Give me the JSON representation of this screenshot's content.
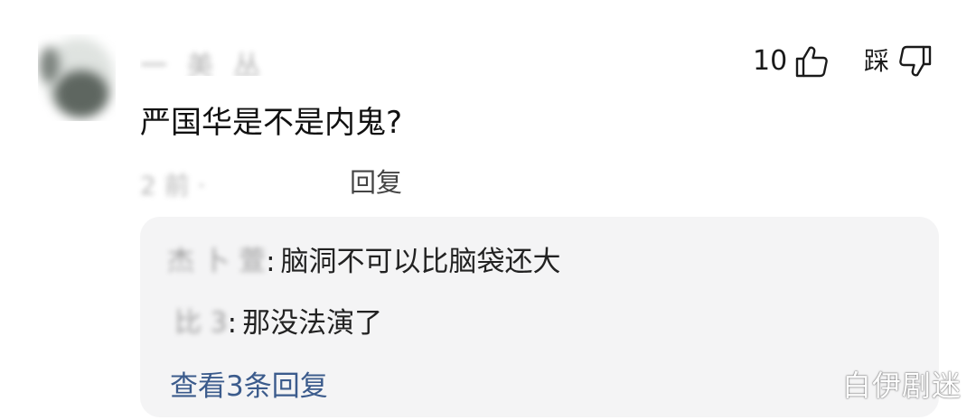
{
  "comment": {
    "username": "一 美 丛",
    "like_count": "10",
    "dislike_label": "踩",
    "text": "严国华是不是内鬼?",
    "meta_prefix": "2  前 ·",
    "reply_label": "回复"
  },
  "replies": {
    "items": [
      {
        "author": "杰 卜 萱",
        "separator": ":",
        "text": "脑洞不可以比脑袋还大"
      },
      {
        "author": "比  3",
        "separator": ":",
        "text": "那没法演了"
      }
    ],
    "view_more_label": "查看3条回复"
  },
  "watermark": "白伊剧迷",
  "colors": {
    "link_blue": "#3b5b8c",
    "reply_bg": "#f4f4f5",
    "text_dark": "#1a1a1a"
  },
  "icons": {
    "like": "thumb-up-icon",
    "dislike": "thumb-down-icon"
  }
}
